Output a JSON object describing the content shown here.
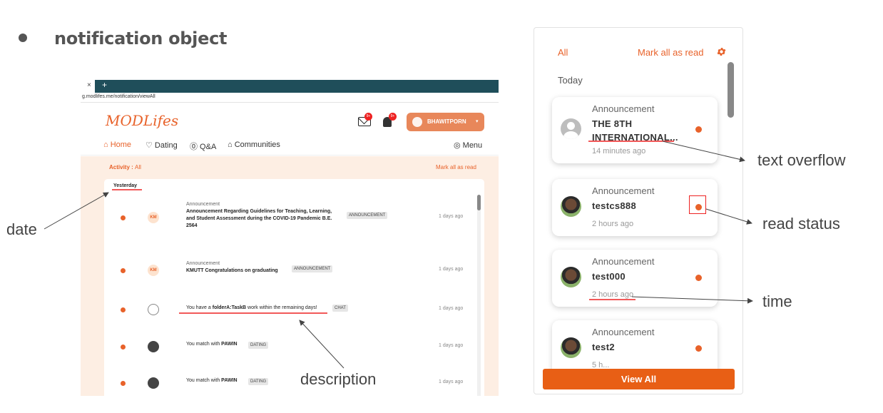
{
  "heading": "notification object",
  "screenshot": {
    "tab_close": "×",
    "tab_new": "+",
    "url": "g.modlifes.me/notification/viewAll",
    "logo": "MODLifes",
    "mail_badge": "9+",
    "bell_badge": "9+",
    "user_name": "BHAWITPORN",
    "user_caret": "▾",
    "nav": {
      "home": "⌂ Home",
      "dating": "♡ Dating",
      "qa": "⓪ Q&A",
      "communities": "⌂ Communities",
      "menu": "◎ Menu"
    },
    "activity_label": "Activity :",
    "activity_value": "All",
    "mark_all_read": "Mark all as read",
    "date_header": "Yesterday",
    "rows": [
      {
        "avatar_text": "KM",
        "title": "Announcement",
        "body": "Announcement Regarding Guidelines for Teaching, Learning, and Student Assessment during the COVID-19 Pandemic B.E. 2564",
        "tag": "ANNOUNCEMENT",
        "ago": "1 days ago"
      },
      {
        "avatar_text": "KM",
        "title": "Announcement",
        "body": "KMUTT Congratulations on graduating",
        "tag": "ANNOUNCEMENT",
        "ago": "1 days ago"
      },
      {
        "desc_prefix": "You have a ",
        "desc_bold": "folderA:TaskB",
        "desc_suffix": " work within the remaining days!",
        "tag": "CHAT",
        "ago": "1 days ago"
      },
      {
        "desc_prefix": "You match with ",
        "desc_bold": "PAWIN",
        "tag": "DATING",
        "ago": "1 days ago"
      },
      {
        "desc_prefix": "You match with ",
        "desc_bold": "PAWIN",
        "tag": "DATING",
        "ago": "1 days ago"
      }
    ]
  },
  "annotations": {
    "date": "date",
    "description": "description",
    "text_overflow": "text overflow",
    "read_status": "read status",
    "time": "time"
  },
  "panel": {
    "filter_all": "All",
    "mark_all_read": "Mark all as read",
    "section_today": "Today",
    "notifications": [
      {
        "kind": "Announcement",
        "title_line1": "THE 8TH",
        "title_line2": "INTERNATIONAL...",
        "time": "14 minutes ago",
        "unread": true
      },
      {
        "kind": "Announcement",
        "title_line1": "testcs888",
        "time": "2 hours ago",
        "unread": true
      },
      {
        "kind": "Announcement",
        "title_line1": "test000",
        "time": "2 hours ago",
        "unread": true
      },
      {
        "kind": "Announcement",
        "title_line1": "test2",
        "time": "5 h...",
        "unread": true
      }
    ],
    "view_all": "View All"
  },
  "colors": {
    "accent": "#e8622a",
    "button": "#e85f15",
    "annotation_red": "#e22222",
    "tabbar": "#1f4e5a"
  }
}
